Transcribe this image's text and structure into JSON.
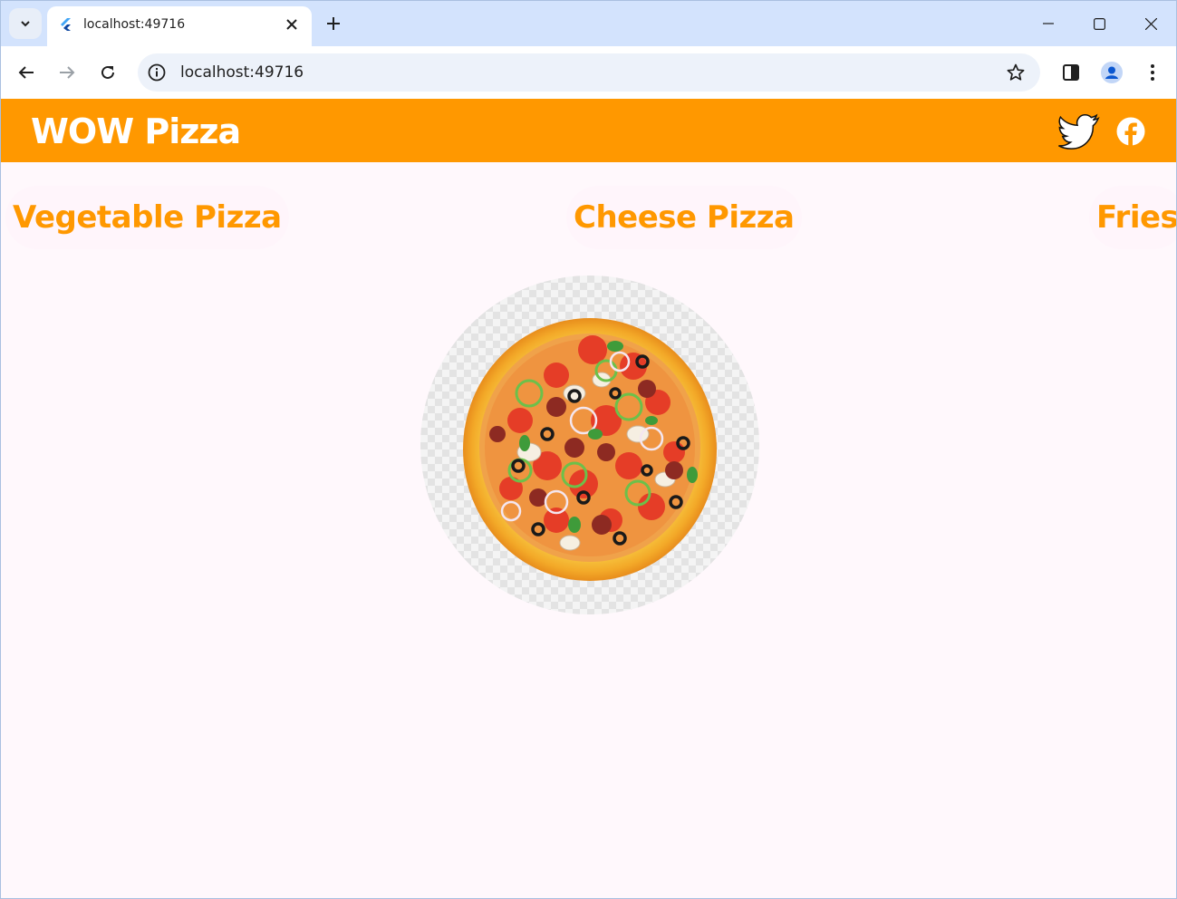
{
  "browser": {
    "tab": {
      "title": "localhost:49716"
    },
    "address_bar": {
      "url": "localhost:49716"
    }
  },
  "app": {
    "title": "WOW Pizza",
    "accent_color": "#ff9800",
    "actions": [
      {
        "icon": "twitter-icon"
      },
      {
        "icon": "facebook-icon"
      }
    ]
  },
  "menu": {
    "items": [
      {
        "label": "Vegetable Pizza"
      },
      {
        "label": "Cheese Pizza"
      },
      {
        "label": "Fries"
      }
    ]
  },
  "hero_image": {
    "subject": "pizza"
  }
}
